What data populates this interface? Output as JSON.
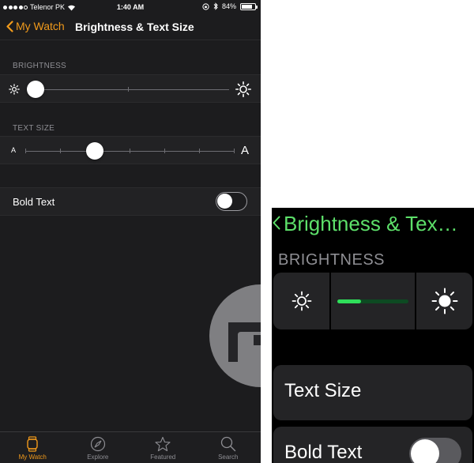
{
  "status_bar": {
    "carrier": "Telenor PK",
    "time": "1:40 AM",
    "battery": "84%",
    "battery_level": 0.84,
    "signal_bars": 4
  },
  "nav": {
    "back_label": "My Watch",
    "title": "Brightness & Text Size"
  },
  "brightness": {
    "section_label": "BRIGHTNESS",
    "level": 0.0,
    "min_icon": "sun-small-icon",
    "max_icon": "sun-large-icon"
  },
  "text_size": {
    "section_label": "TEXT SIZE",
    "small_glyph": "A",
    "large_glyph": "A",
    "steps": 7,
    "selected_step": 2
  },
  "bold_text": {
    "label": "Bold Text",
    "enabled": false
  },
  "tab_bar": {
    "tabs": [
      {
        "label": "My Watch",
        "icon": "watch-icon",
        "active": true
      },
      {
        "label": "Explore",
        "icon": "compass-icon",
        "active": false
      },
      {
        "label": "Featured",
        "icon": "star-icon",
        "active": false
      },
      {
        "label": "Search",
        "icon": "magnifier-icon",
        "active": false
      }
    ]
  },
  "watch": {
    "title": "Brightness & Tex…",
    "brightness_label": "BRIGHTNESS",
    "brightness_level": 0.33,
    "text_size_label": "Text Size",
    "bold_text_label": "Bold Text",
    "bold_text_enabled": false
  },
  "colors": {
    "ios_accent": "#f19a1b",
    "watch_accent": "#5de06a",
    "watch_bar_fill": "#2fde5a",
    "background": "#1c1c1e"
  }
}
